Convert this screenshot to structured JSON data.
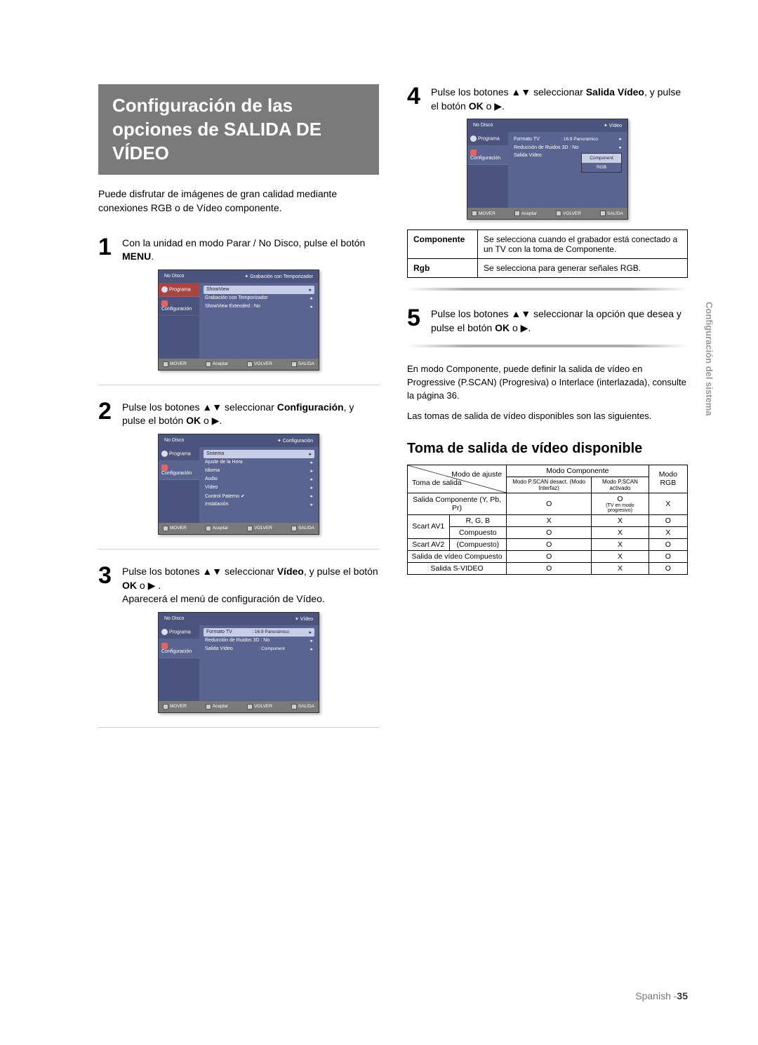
{
  "title": "Configuración de las opciones de SALIDA DE VÍDEO",
  "intro": "Puede disfrutar de imágenes de gran calidad mediante conexiones RGB o de Vídeo componente.",
  "side_label": "Configuración del sistema",
  "footer": {
    "lang": "Spanish",
    "page": "35"
  },
  "steps": {
    "s1": "Con la unidad en modo Parar / No Disco, pulse el botón MENU.",
    "s2": "Pulse los botones ▲▼ seleccionar Configuración, y pulse el botón OK o ▶.",
    "s3a": "Pulse los botones ▲▼ seleccionar Vídeo, y pulse el botón OK o ▶ .",
    "s3b": "Aparecerá el menú de configuración de Vídeo.",
    "s4": "Pulse los botones ▲▼ seleccionar Salida Vídeo, y pulse el botón OK o ▶.",
    "s5": "Pulse los botones ▲▼ seleccionar la opción que desea y pulse el botón OK o ▶."
  },
  "para_component": "En modo Componente, puede definir la salida de vídeo en Progressive (P.SCAN) (Progresiva) o Interlace (interlazada), consulte la página 36.",
  "para_outputs": "Las tomas de salida de vídeo disponibles son las siguientes.",
  "subheading": "Toma de salida de vídeo disponible",
  "defs": {
    "componente": {
      "label": "Componente",
      "text": "Se selecciona cuando el grabador está conectado a un TV con la toma de Componente."
    },
    "rgb": {
      "label": "Rgb",
      "text": "Se selecciona para generar señales RGB."
    }
  },
  "osd_common": {
    "no_disc": "No Disco",
    "programa": "Programa",
    "configuracion": "Configuración",
    "mover": "MOVER",
    "aceptar": "Aceptar",
    "volver": "VOLVER",
    "salida": "SALIDA"
  },
  "osd1": {
    "crumb": "Grabación con Temporizador",
    "rows": [
      "ShowView",
      "Grabación con Temporizador",
      "ShowView Extended : No"
    ]
  },
  "osd2": {
    "crumb": "Configuración",
    "rows": [
      "Sistema",
      "Ajuste de la Hora",
      "Idioma",
      "Audio",
      "Vídeo",
      "Control Paterno ✔",
      "Instalación"
    ]
  },
  "osd3": {
    "crumb": "Vídeo",
    "rows": [
      {
        "k": "Formato TV",
        "v": ": 16:9 Panorámico",
        "hl": true
      },
      {
        "k": "Reducción de Ruidos 3D : No",
        "v": ""
      },
      {
        "k": "Salida Vídeo",
        "v": ": Component"
      }
    ]
  },
  "osd4": {
    "crumb": "Vídeo",
    "rows": [
      {
        "k": "Formato TV",
        "v": ": 16:9 Panorámico"
      },
      {
        "k": "Reducción de Ruidos 3D : No",
        "v": ""
      },
      {
        "k": "Salida Vídeo",
        "v": ""
      }
    ],
    "popup": [
      "Component",
      "RGB"
    ]
  },
  "avail": {
    "corner_top": "Modo de ajuste",
    "corner_bottom": "Toma de salida",
    "col_mode_comp": "Modo Componente",
    "col_pscan_off": "Modo P.SCAN desact.",
    "col_interlace": "(Modo Interfaz)",
    "col_pscan_on": "Modo P.SCAN activado",
    "col_rgb": "Modo RGB",
    "rows": [
      {
        "label": "Salida Componente (Y, Pb, Pr)",
        "c1": "O",
        "c2": "O",
        "c2note": "(TV en modo progresivo)",
        "c3": "X"
      },
      {
        "label_group": "Scart AV1",
        "label": "R, G, B",
        "c1": "X",
        "c2": "X",
        "c3": "O"
      },
      {
        "label_group": "Scart AV1",
        "label": "Compuesto",
        "c1": "O",
        "c2": "X",
        "c3": "X"
      },
      {
        "label_group": "Scart AV2",
        "label": "(Compuesto)",
        "c1": "O",
        "c2": "X",
        "c3": "O"
      },
      {
        "label": "Salida de vídeo Compuesto",
        "c1": "O",
        "c2": "X",
        "c3": "O"
      },
      {
        "label": "Salida S-VIDEO",
        "c1": "O",
        "c2": "X",
        "c3": "O"
      }
    ]
  }
}
